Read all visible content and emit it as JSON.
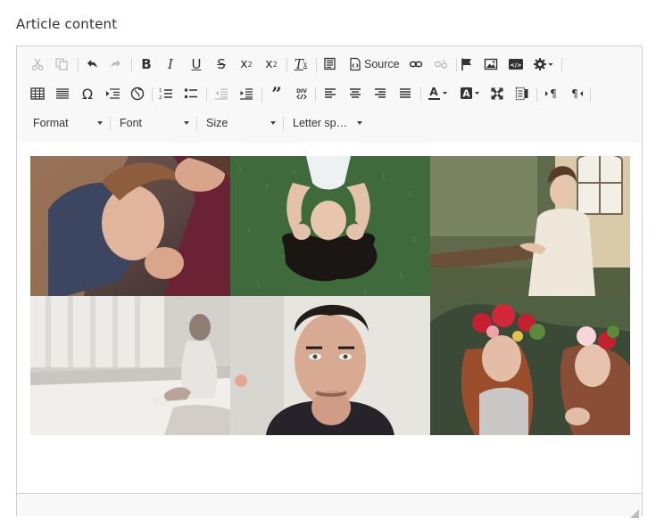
{
  "field": {
    "label": "Article content"
  },
  "toolbar": {
    "source_label": "Source",
    "row1_icons": [
      "cut-icon",
      "copy-icon",
      "undo-icon",
      "redo-icon",
      "bold-icon",
      "italic-icon",
      "underline-icon",
      "strikethrough-icon",
      "subscript-icon",
      "superscript-icon",
      "remove-format-icon",
      "paste-text-icon",
      "source-icon",
      "link-icon",
      "unlink-icon",
      "anchor-flag-icon",
      "image-icon",
      "embed-media-icon",
      "settings-gear-icon"
    ],
    "row2_icons": [
      "table-icon",
      "horizontal-rule-icon",
      "special-char-omega-icon",
      "page-break-icon",
      "iframe-globe-icon",
      "numbered-list-icon",
      "bulleted-list-icon",
      "outdent-icon",
      "indent-icon",
      "blockquote-icon",
      "create-div-icon",
      "align-left-icon",
      "align-center-icon",
      "align-right-icon",
      "justify-icon",
      "text-color-icon",
      "background-color-icon",
      "maximize-icon",
      "show-blocks-icon",
      "ltr-icon",
      "rtl-icon"
    ],
    "combos": {
      "format": "Format",
      "font": "Font",
      "size": "Size",
      "letter_spacing": "Letter sp…"
    }
  },
  "content": {
    "photos": [
      {
        "desc": "couple-embrace",
        "colors": [
          "#5a4a4c",
          "#c9a38b",
          "#6b2a3a"
        ]
      },
      {
        "desc": "woman-on-grass",
        "colors": [
          "#3f6a3a",
          "#e9e6e0",
          "#1c1c1c"
        ]
      },
      {
        "desc": "woman-at-fence",
        "colors": [
          "#8a8a6a",
          "#e8e2d5",
          "#5a4a3a"
        ]
      },
      {
        "desc": "woman-in-bedroom",
        "colors": [
          "#d9d6d2",
          "#f3f1ee",
          "#8a7e76"
        ]
      },
      {
        "desc": "man-portrait",
        "colors": [
          "#e3e0da",
          "#2a2625",
          "#c89b82"
        ]
      },
      {
        "desc": "floral-crown-women",
        "colors": [
          "#3d4a36",
          "#9e4a2a",
          "#c8283a"
        ]
      }
    ]
  },
  "colors": {
    "border": "#d1d1d1",
    "toolbar_bg": "#f8f8f8",
    "icon": "#333333",
    "disabled_icon": "#bdbdbd"
  }
}
